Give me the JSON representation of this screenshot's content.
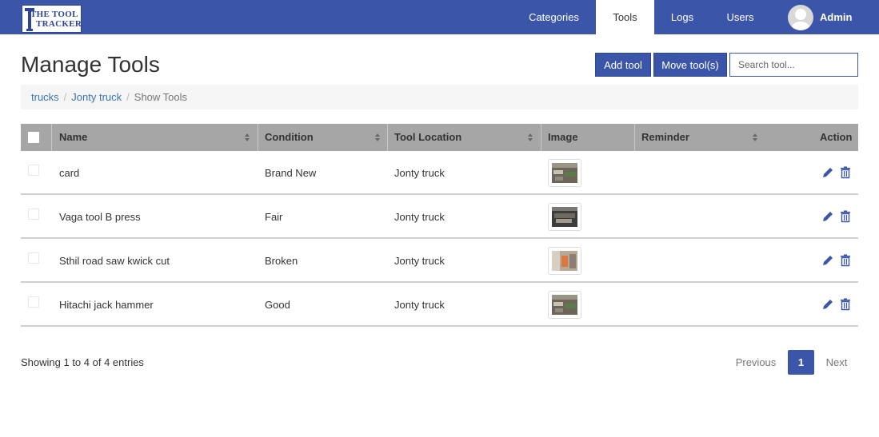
{
  "brand": {
    "line1": "THE TOOL",
    "line2": "TRACKER"
  },
  "nav": {
    "categories": "Categories",
    "tools": "Tools",
    "logs": "Logs",
    "users": "Users",
    "admin": "Admin"
  },
  "header": {
    "title": "Manage Tools",
    "add_tool": "Add tool",
    "move_tools": "Move tool(s)",
    "search_placeholder": "Search tool..."
  },
  "breadcrumb": {
    "items": [
      "trucks",
      "Jonty truck"
    ],
    "current": "Show Tools",
    "separator": "/"
  },
  "table": {
    "columns": [
      "Name",
      "Condition",
      "Tool Location",
      "Image",
      "Reminder",
      "Action"
    ],
    "rows": [
      {
        "name": "card",
        "condition": "Brand New",
        "location": "Jonty truck",
        "reminder": ""
      },
      {
        "name": "Vaga tool B press",
        "condition": "Fair",
        "location": "Jonty truck",
        "reminder": ""
      },
      {
        "name": "Sthil road saw kwick cut",
        "condition": "Broken",
        "location": "Jonty truck",
        "reminder": ""
      },
      {
        "name": "Hitachi jack hammer",
        "condition": "Good",
        "location": "Jonty truck",
        "reminder": ""
      }
    ]
  },
  "footer": {
    "info": "Showing 1 to 4 of 4 entries",
    "previous": "Previous",
    "page": "1",
    "next": "Next"
  },
  "colors": {
    "primary": "#3b56a8",
    "header_bg": "#a6a6a6",
    "breadcrumb_bg": "#f5f5f5",
    "link": "#3a73b8"
  },
  "icons": [
    "hammer-logo-icon",
    "avatar-icon",
    "sort-icon",
    "pencil-icon",
    "trash-icon"
  ]
}
